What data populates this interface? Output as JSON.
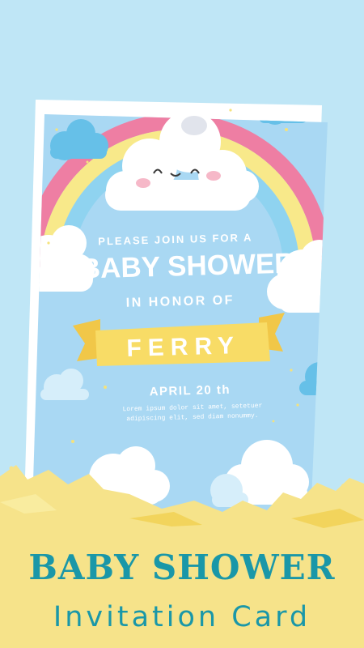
{
  "card": {
    "intro": "PLEASE JOIN US FOR A",
    "headline": "BABY SHOWER",
    "honor": "IN HONOR OF",
    "name": "FERRY",
    "date": "APRIL 20 th",
    "body_line1": "Lorem ipsum dolor sit amet, setetuer",
    "body_line2": "adipiscing elit, sed diam nonummy."
  },
  "footer": {
    "title": "BABY SHOWER",
    "subtitle": "Invitation Card"
  },
  "colors": {
    "background": "#bfe6f6",
    "card": "#a9d8f3",
    "rainbow_pink": "#ee7ea3",
    "rainbow_yellow": "#f8e98a",
    "rainbow_blue": "#8fd3f0",
    "ribbon": "#f7d75a",
    "title_teal": "#1a97a8"
  }
}
